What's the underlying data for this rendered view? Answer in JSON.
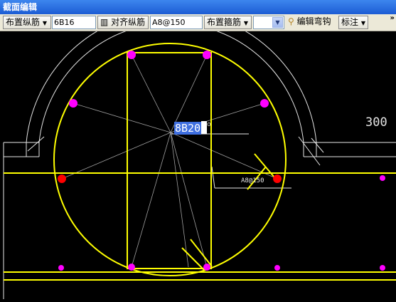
{
  "window": {
    "title": "截面编辑"
  },
  "toolbar": {
    "place_long_label": "布置纵筋",
    "long_value": "6B16",
    "align_long_label": "对齐纵筋",
    "align_value": "A8@150",
    "place_stirrup_label": "布置箍筋",
    "empty_select_value": "",
    "edit_hook_label": "编辑弯钩",
    "annotate_label": "标注",
    "overflow": "»"
  },
  "canvas": {
    "edit_value": "8B20",
    "edit_tail": "о",
    "dimension_label": "300",
    "stirrup_label": "A8@150"
  },
  "colors": {
    "background": "#000000",
    "section_line": "#ffff00",
    "rebar_selected": "#ff00ff",
    "rebar_active": "#ff0000",
    "annotation": "#ffffff"
  }
}
